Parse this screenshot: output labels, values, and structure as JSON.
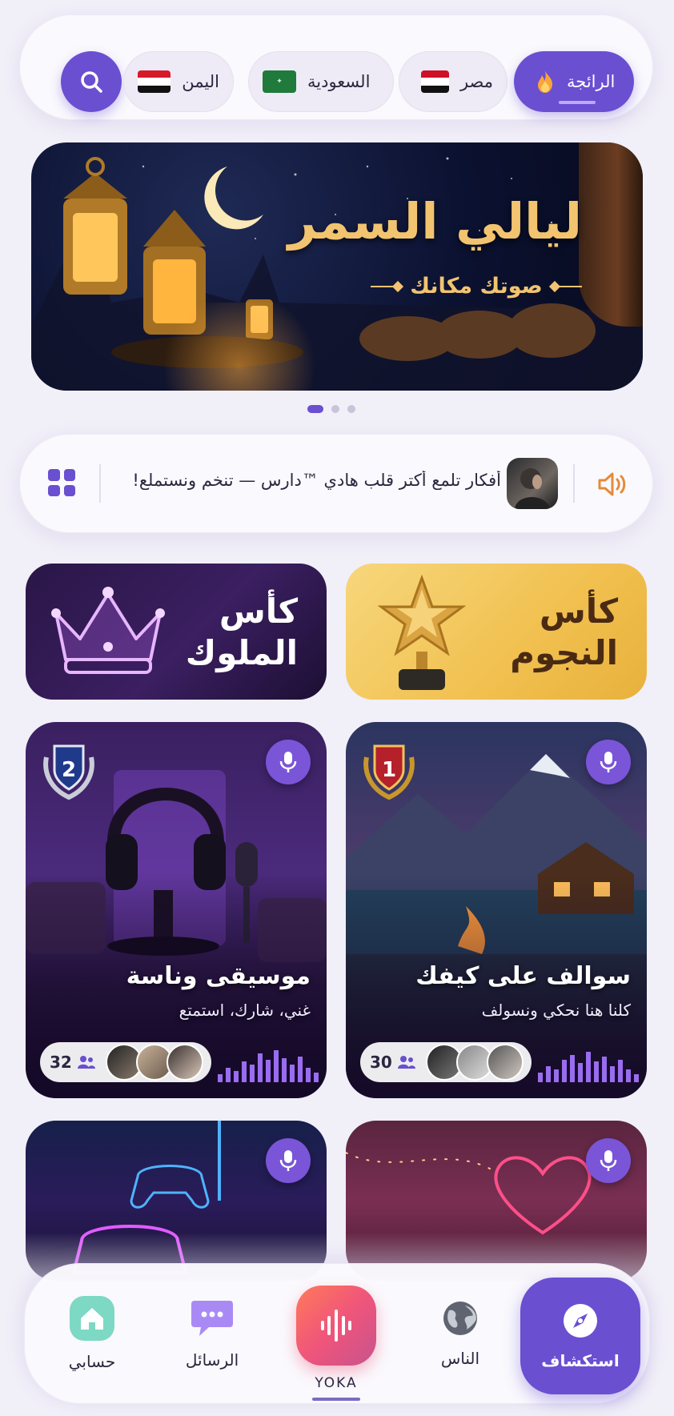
{
  "top_tabs": {
    "trending": "الرائجة",
    "egypt": "مصر",
    "saudi": "السعودية",
    "yemen": "اليمن"
  },
  "banner": {
    "title": "ليالي السمر",
    "subtitle": "صوتك مكانك",
    "slide_count": 3,
    "active_slide": 1
  },
  "ticker": {
    "text": "أفكار تلمع أكتر قلب هادي ™دارس — تنخم ونستملع!"
  },
  "cups": {
    "stars": "كأس النجوم",
    "kings": "كأس الملوك"
  },
  "rooms": [
    {
      "title": "سوالف على كيفك",
      "subtitle": "كلنا هنا نحكي ونسولف",
      "members": "30",
      "rank": "1"
    },
    {
      "title": "موسيقى وناسة",
      "subtitle": "غني، شارك، استمتع",
      "members": "32",
      "rank": "2"
    },
    {
      "title": "",
      "subtitle": "",
      "members": "",
      "rank": ""
    },
    {
      "title": "",
      "subtitle": "",
      "members": "",
      "rank": ""
    }
  ],
  "bottom_nav": {
    "explore": "استكشاف",
    "people": "الناس",
    "yoka": "YOKA",
    "messages": "الرسائل",
    "account": "حسابي"
  },
  "colors": {
    "accent": "#6a4fd1",
    "background": "#f1eff8",
    "gold": "#f2c470",
    "speaker": "#e58a3a"
  }
}
